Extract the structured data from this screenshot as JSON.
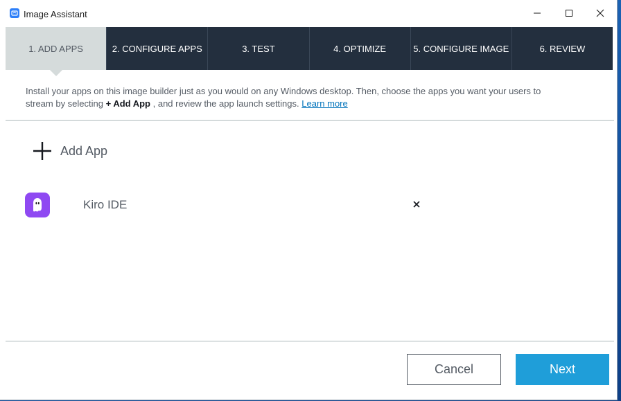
{
  "window": {
    "title": "Image Assistant"
  },
  "steps": [
    {
      "label": "1. ADD APPS",
      "active": true
    },
    {
      "label": "2. CONFIGURE APPS",
      "active": false
    },
    {
      "label": "3. TEST",
      "active": false
    },
    {
      "label": "4. OPTIMIZE",
      "active": false
    },
    {
      "label": "5. CONFIGURE IMAGE",
      "active": false
    },
    {
      "label": "6. REVIEW",
      "active": false
    }
  ],
  "description": {
    "line1": "Install your apps on this image builder just as you would on any Windows desktop. Then, choose the apps you want your users to",
    "line2_prefix": "stream by selecting ",
    "line2_bold": "+ Add App",
    "line2_suffix": " , and review the app launch settings. ",
    "link": "Learn more"
  },
  "add_app_label": "Add App",
  "apps": [
    {
      "name": "Kiro IDE",
      "icon": "kiro-ghost-icon"
    }
  ],
  "buttons": {
    "cancel": "Cancel",
    "next": "Next"
  },
  "colors": {
    "nav_bg": "#232f3e",
    "active_step_bg": "#d5dbdb",
    "next_button": "#1f9ed9",
    "kiro_icon": "#8f49f2",
    "link": "#0073bb"
  }
}
